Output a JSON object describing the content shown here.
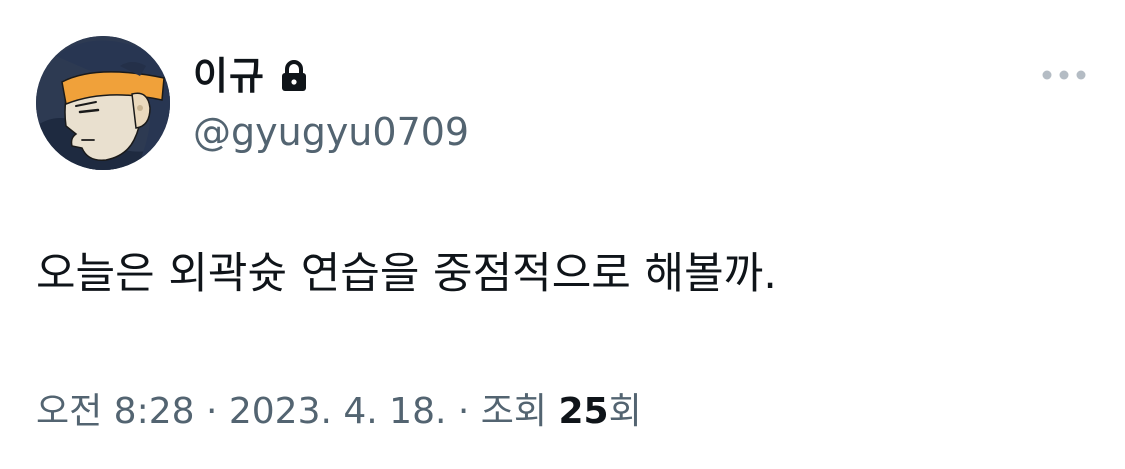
{
  "user": {
    "display_name": "이규",
    "handle": "@gyugyu0709",
    "avatar_icon": "cartoon-character-avatar",
    "protected_icon": "lock-icon"
  },
  "tweet": {
    "text": "오늘은 외곽슛 연습을 중점적으로 해볼까."
  },
  "meta": {
    "time": "오전 8:28",
    "separator_1": " · ",
    "date": "2023. 4. 18.",
    "separator_2": " · ",
    "views_label": "조회 ",
    "views_count": "25",
    "views_suffix": "회"
  },
  "actions": {
    "more_icon": "more-horizontal-icon"
  },
  "colors": {
    "primary_text": "#0f1419",
    "secondary_text": "#536471",
    "more_dots": "#b4bcc4",
    "background": "#ffffff"
  }
}
